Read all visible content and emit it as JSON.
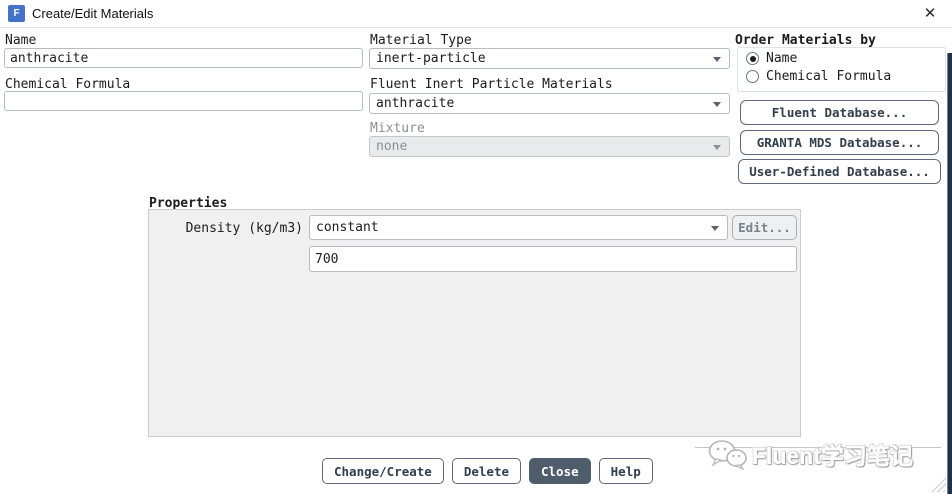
{
  "window": {
    "title": "Create/Edit Materials",
    "app_icon_letter": "F",
    "close_glyph": "✕"
  },
  "fields": {
    "name": {
      "label": "Name",
      "value": "anthracite"
    },
    "chemical_formula": {
      "label": "Chemical Formula",
      "value": ""
    },
    "material_type": {
      "label": "Material Type",
      "value": "inert-particle"
    },
    "fluent_materials": {
      "label": "Fluent Inert Particle Materials",
      "value": "anthracite"
    },
    "mixture": {
      "label": "Mixture",
      "value": "none",
      "disabled": true
    }
  },
  "order_materials": {
    "label": "Order Materials by",
    "options": [
      {
        "label": "Name",
        "selected": true
      },
      {
        "label": "Chemical Formula",
        "selected": false
      }
    ]
  },
  "database_buttons": [
    "Fluent Database...",
    "GRANTA MDS Database...",
    "User-Defined Database..."
  ],
  "properties": {
    "label": "Properties",
    "density": {
      "label": "Density (kg/m3)",
      "method": "constant",
      "edit_label": "Edit...",
      "value": "700"
    }
  },
  "footer_buttons": [
    {
      "label": "Change/Create",
      "primary": false
    },
    {
      "label": "Delete",
      "primary": false
    },
    {
      "label": "Close",
      "primary": true
    },
    {
      "label": "Help",
      "primary": false
    }
  ],
  "watermark": {
    "text": "Fluent学习笔记",
    "icon": "wechat-icon"
  },
  "colors": {
    "titlebar_icon_bg": "#4472c8",
    "primary_button_bg": "#4e5c6c",
    "properties_panel_bg": "#f0f0f0",
    "disabled_field_bg": "#e9eaeb",
    "side_strip": "#223149",
    "button_text": "#333e4b"
  }
}
